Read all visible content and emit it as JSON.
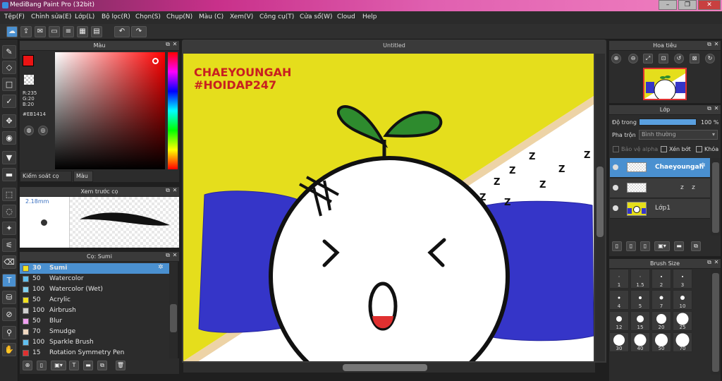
{
  "app": {
    "title": "MediBang Paint Pro (32bit)"
  },
  "menu": [
    "Tệp(F)",
    "Chỉnh sửa(E)",
    "Lớp(L)",
    "Bộ lọc(R)",
    "Chọn(S)",
    "Chụp(N)",
    "Màu (C)",
    "Xem(V)",
    "Công cụ(T)",
    "Cửa sổ(W)",
    "Cloud",
    "Help"
  ],
  "color_panel": {
    "title": "Màu",
    "r": "R:235",
    "g": "G:20",
    "b": "B:20",
    "hex": "#EB1414",
    "tab_brush_control": "Kiểm soát cọ",
    "tab_color": "Màu"
  },
  "brush_preview": {
    "title": "Xem trước cọ",
    "size": "2.18mm"
  },
  "brush_panel": {
    "title": "Cọ: Sumi",
    "items": [
      {
        "size": "30",
        "name": "Sumi",
        "color": "#f0e020",
        "selected": true
      },
      {
        "size": "50",
        "name": "Watercolor",
        "color": "#60c0f0"
      },
      {
        "size": "100",
        "name": "Watercolor (Wet)",
        "color": "#80d0f0"
      },
      {
        "size": "50",
        "name": "Acrylic",
        "color": "#f0e020"
      },
      {
        "size": "100",
        "name": "Airbrush",
        "color": "#d0d0d0"
      },
      {
        "size": "50",
        "name": "Blur",
        "color": "#f0a0f0"
      },
      {
        "size": "70",
        "name": "Smudge",
        "color": "#f0d8c0"
      },
      {
        "size": "100",
        "name": "Sparkle Brush",
        "color": "#60c0f0"
      },
      {
        "size": "15",
        "name": "Rotation Symmetry Pen",
        "color": "#e03030"
      }
    ]
  },
  "canvas": {
    "tab": "Untitled",
    "text_line1": "CHAEYOUNGAH",
    "text_line2": "#HOIDAP247",
    "zzz": "Z"
  },
  "navigator": {
    "title": "Hoa tiêu"
  },
  "layers": {
    "title": "Lớp",
    "opacity_label": "Độ trong",
    "opacity_value": "100 %",
    "blend_label": "Pha trộn",
    "blend_value": "Bình thường",
    "protect_alpha": "Bảo vệ alpha",
    "clip": "Xén bớt",
    "lock": "Khóa",
    "items": [
      {
        "name": "Chaeyoungah",
        "selected": true
      },
      {
        "name": "z    z",
        "selected": false
      },
      {
        "name": "Lớp1",
        "selected": false
      }
    ]
  },
  "brush_size": {
    "title": "Brush Size",
    "sizes": [
      "1",
      "1.5",
      "2",
      "3",
      "4",
      "5",
      "7",
      "10",
      "12",
      "15",
      "20",
      "25",
      "30",
      "40",
      "50",
      "70"
    ]
  },
  "colors": {
    "accent": "#4a90d0",
    "selected_layer": "#4a90d0",
    "fg": "#eb1414"
  }
}
